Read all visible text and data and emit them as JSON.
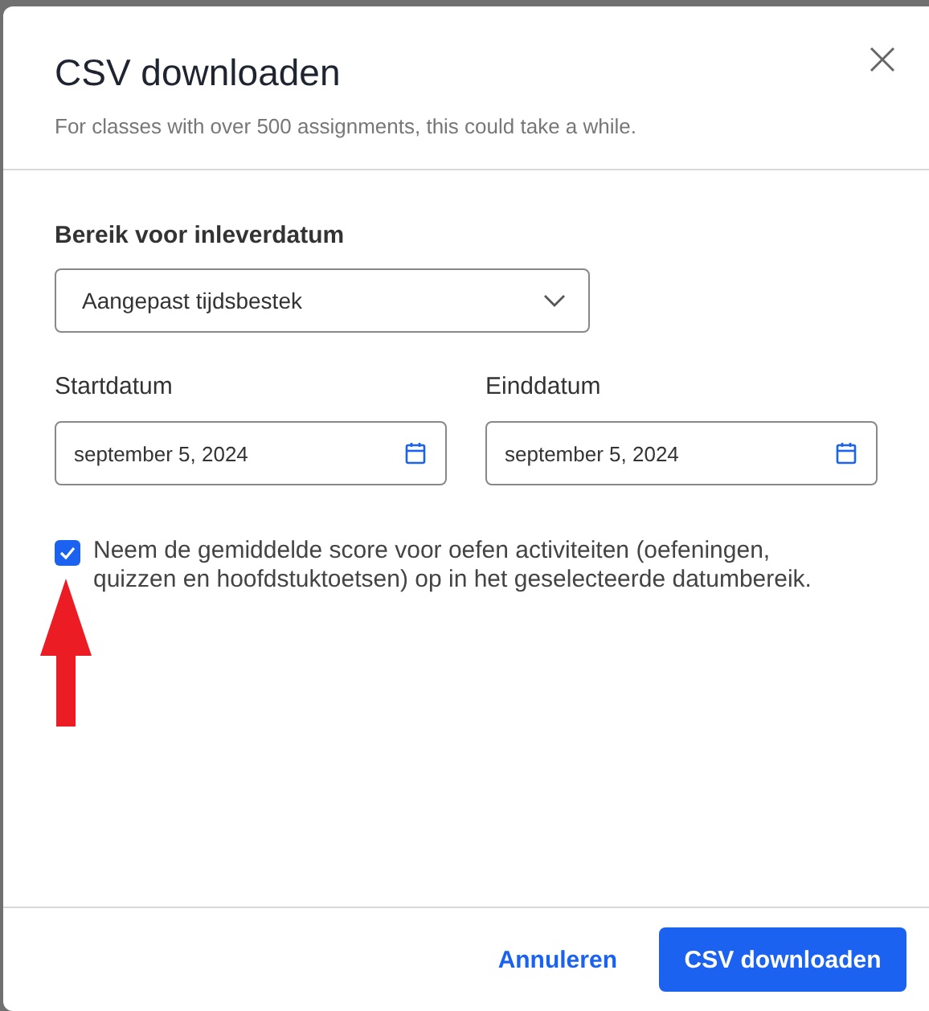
{
  "dialog": {
    "title": "CSV downloaden",
    "subtitle": "For classes with over 500 assignments, this could take a while."
  },
  "range": {
    "label": "Bereik voor inleverdatum",
    "value": "Aangepast tijdsbestek"
  },
  "dates": [
    {
      "label": "Startdatum",
      "value": "september 5, 2024"
    },
    {
      "label": "Einddatum",
      "value": "september 5, 2024"
    }
  ],
  "option": {
    "checked": true,
    "label": "Neem de gemiddelde score voor oefen activiteiten (oefeningen, quizzen en hoofdstuktoetsen) op in het geselecteerde datumbereik."
  },
  "buttons": [
    {
      "kind": "link",
      "label": "Annuleren"
    },
    {
      "kind": "primary",
      "label": "CSV downloaden"
    }
  ]
}
